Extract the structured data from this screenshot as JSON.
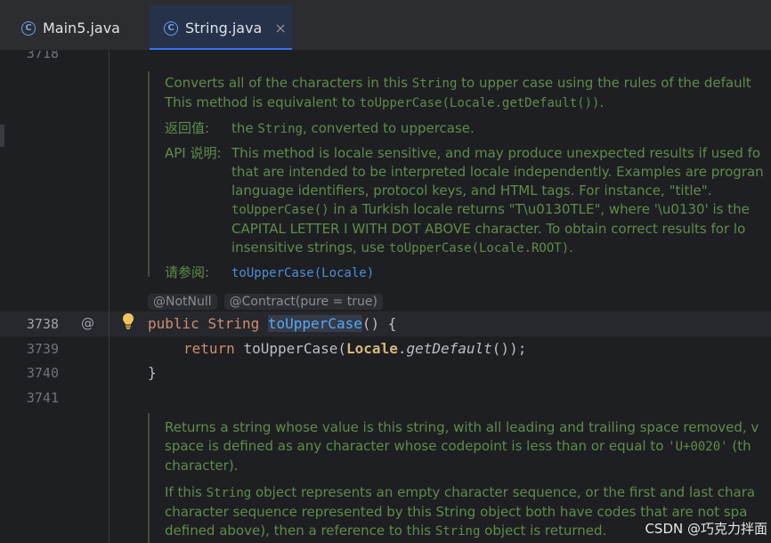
{
  "tabs": [
    {
      "label": "Main5.java",
      "icon": "class-icon",
      "active": false
    },
    {
      "label": "String.java",
      "icon": "class-icon",
      "active": true,
      "close": "×"
    }
  ],
  "gutter": {
    "partial": "3718",
    "lines": [
      "3738",
      "3739",
      "3740",
      "3741"
    ]
  },
  "doc1": {
    "p1_line1_a": "Converts all of the characters in this ",
    "p1_line1_code": "String",
    "p1_line1_b": " to upper case using the rules of the default",
    "p1_line2_a": "This method is equivalent to ",
    "p1_line2_code": "toUpperCase(Locale.getDefault())",
    "p1_line2_b": ".",
    "returns_tag": "返回值:",
    "returns_a": "the ",
    "returns_code": "String",
    "returns_b": ", converted to uppercase.",
    "api_tag": "API 说明:",
    "api_l1": "This method is locale sensitive, and may produce unexpected results if used fo",
    "api_l2": "that are intended to be interpreted locale independently. Examples are progran",
    "api_l3": "language identifiers, protocol keys, and HTML tags. For instance, \"title\".",
    "api_l4_code": "toUpperCase()",
    "api_l4_b": " in a Turkish locale returns \"T\\u0130TLE\", where '\\u0130' is the",
    "api_l5": "CAPITAL LETTER I WITH DOT ABOVE character. To obtain correct results for lo",
    "api_l6_a": "insensitive strings, use ",
    "api_l6_code": "toUpperCase(Locale.ROOT)",
    "api_l6_b": ".",
    "see_tag": "请参阅:",
    "see_link": "toUpperCase(Locale)"
  },
  "inlays": [
    "@NotNull",
    "@Contract(pure = true)"
  ],
  "code": {
    "l1_public": "public",
    "l1_type": "String",
    "l1_method": "toUpperCase",
    "l1_rest": "() {",
    "l2_return": "return",
    "l2_call": "toUpperCase(",
    "l2_locale": "Locale",
    "l2_dot": ".",
    "l2_getdefault": "getDefault",
    "l2_end": "());",
    "l3": "}"
  },
  "doc2": {
    "l1": "Returns a string whose value is this string, with all leading and trailing space removed, v",
    "l2_a": "space is defined as any character whose codepoint is less than or equal to ",
    "l2_code": "'U+0020'",
    "l2_b": " (th",
    "l3": "character).",
    "l4_a": "If this ",
    "l4_code": "String",
    "l4_b": " object represents an empty character sequence, or the first and last chara",
    "l5": "character sequence represented by this String object both have codes that are not spa",
    "l6_a": "defined above), then a reference to this ",
    "l6_code": "String",
    "l6_b": " object is returned."
  },
  "gutter_icons": {
    "at": "@"
  },
  "watermark": "CSDN @巧克力拌面",
  "colors": {
    "accent": "#3574f0",
    "doc_text": "#5f8c4a",
    "keyword": "#cf8e6d",
    "method": "#56a8f5"
  }
}
